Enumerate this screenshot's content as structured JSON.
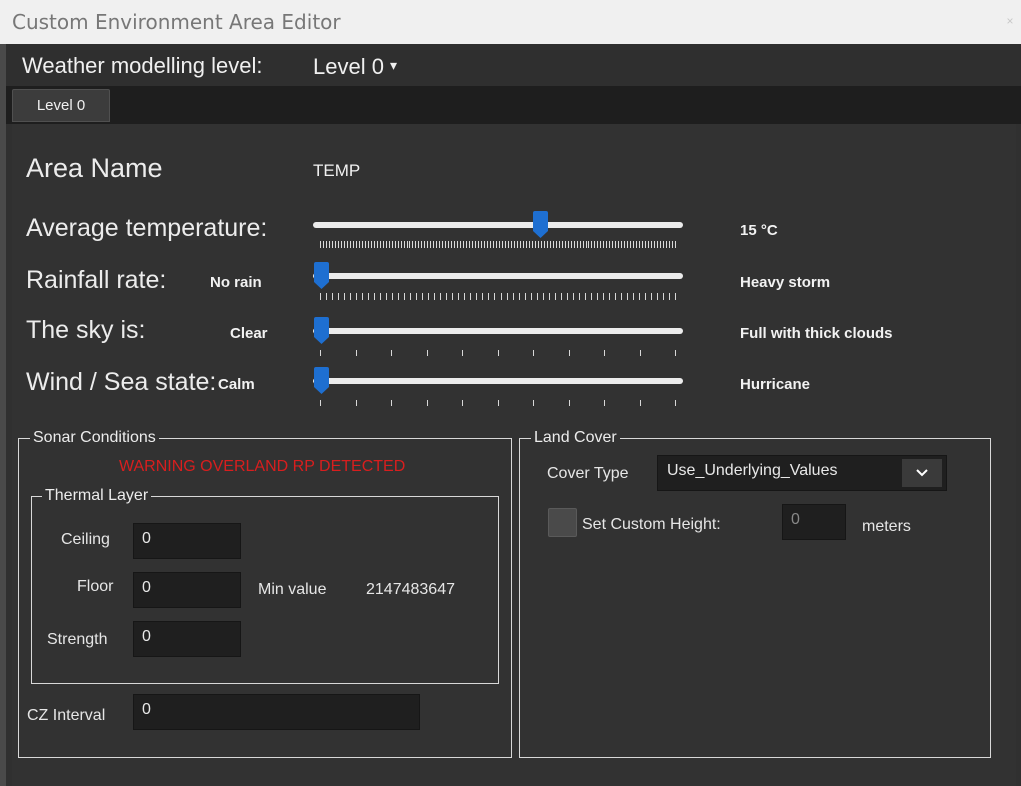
{
  "window": {
    "title": "Custom Environment Area Editor",
    "close_symbol": "×"
  },
  "weather": {
    "label": "Weather modelling level:",
    "value": "Level 0"
  },
  "tabs": [
    {
      "label": "Level 0"
    }
  ],
  "area": {
    "label": "Area Name",
    "value": "TEMP"
  },
  "sliders": {
    "temperature": {
      "label": "Average temperature:",
      "min_label": "",
      "max_label": "15 °C",
      "level": 0.62
    },
    "rainfall": {
      "label": "Rainfall rate:",
      "min_label": "No rain",
      "max_label": "Heavy storm",
      "level": 0.0
    },
    "sky": {
      "label": "The sky is:",
      "min_label": "Clear",
      "max_label": "Full with thick clouds",
      "level": 0.0
    },
    "wind": {
      "label": "Wind / Sea state:",
      "min_label": "Calm",
      "max_label": "Hurricane",
      "level": 0.0
    }
  },
  "sonar": {
    "title": "Sonar Conditions",
    "warning": "WARNING OVERLAND RP DETECTED",
    "thermal": {
      "title": "Thermal Layer",
      "ceiling_label": "Ceiling",
      "ceiling_value": "0",
      "floor_label": "Floor",
      "floor_value": "0",
      "min_label": "Min value",
      "min_value": "2147483647",
      "strength_label": "Strength",
      "strength_value": "0"
    },
    "cz_label": "CZ Interval",
    "cz_value": "0"
  },
  "land": {
    "title": "Land Cover",
    "cover_type_label": "Cover Type",
    "cover_type_value": "Use_Underlying_Values",
    "custom_height_label": "Set Custom Height:",
    "custom_height_checked": false,
    "custom_height_value": "0",
    "unit": "meters"
  },
  "colors": {
    "accent": "#1e6fd1",
    "warning": "#d81e1e",
    "background": "#323232"
  }
}
